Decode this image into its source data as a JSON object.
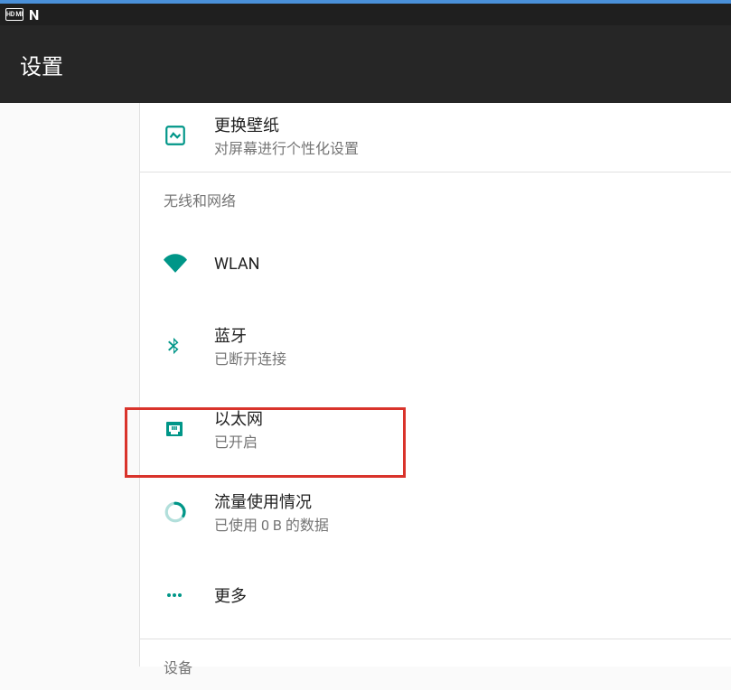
{
  "colors": {
    "accent": "#009688",
    "highlight": "#d9332b"
  },
  "status": {
    "hdmi": "HD MI",
    "n": "N"
  },
  "header": {
    "title": "设置"
  },
  "wallpaper": {
    "title": "更换壁纸",
    "subtitle": "对屏幕进行个性化设置"
  },
  "sections": {
    "wireless": "无线和网络",
    "device": "设备"
  },
  "items": {
    "wlan": {
      "title": "WLAN"
    },
    "bluetooth": {
      "title": "蓝牙",
      "subtitle": "已断开连接"
    },
    "ethernet": {
      "title": "以太网",
      "subtitle": "已开启"
    },
    "datausage": {
      "title": "流量使用情况",
      "subtitle": "已使用 0 B 的数据"
    },
    "more": {
      "title": "更多"
    }
  }
}
